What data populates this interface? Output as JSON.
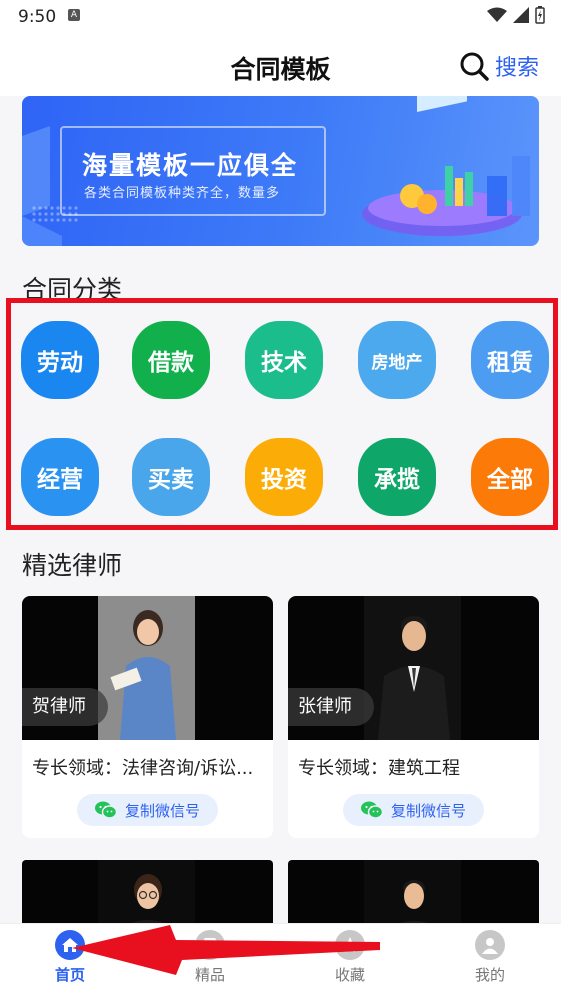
{
  "status_bar": {
    "time": "9:50",
    "a_badge": "A"
  },
  "header": {
    "title": "合同模板",
    "search_label": "搜索"
  },
  "banner": {
    "title": "海量模板一应俱全",
    "subtitle": "各类合同模板种类齐全，数量多"
  },
  "categories_section": {
    "title": "合同分类",
    "items": [
      {
        "label": "劳动",
        "color": "#1a86f0"
      },
      {
        "label": "借款",
        "color": "#12b04c"
      },
      {
        "label": "技术",
        "color": "#1bbd8c"
      },
      {
        "label": "房地产",
        "color": "#4da9ee"
      },
      {
        "label": "租赁",
        "color": "#4c9cf2"
      },
      {
        "label": "经营",
        "color": "#2a93f2"
      },
      {
        "label": "买卖",
        "color": "#4aa6ea"
      },
      {
        "label": "投资",
        "color": "#fcac06"
      },
      {
        "label": "承揽",
        "color": "#0fa66a"
      },
      {
        "label": "全部",
        "color": "#fc7a08"
      }
    ]
  },
  "lawyers_section": {
    "title": "精选律师",
    "lawyers": [
      {
        "name": "贺律师",
        "specialty": "专长领域：法律咨询/诉讼...",
        "wechat_button": "复制微信号"
      },
      {
        "name": "张律师",
        "specialty": "专长领域：建筑工程",
        "wechat_button": "复制微信号"
      }
    ]
  },
  "tabbar": {
    "tabs": [
      {
        "label": "首页",
        "icon": "home-icon",
        "active": true
      },
      {
        "label": "精品",
        "icon": "diamond-icon",
        "active": false
      },
      {
        "label": "收藏",
        "icon": "star-icon",
        "active": false
      },
      {
        "label": "我的",
        "icon": "user-icon",
        "active": false
      }
    ]
  },
  "colors": {
    "accent": "#2d62f0",
    "highlight_box": "#e8101e",
    "annotation_arrow": "#e8101e"
  }
}
